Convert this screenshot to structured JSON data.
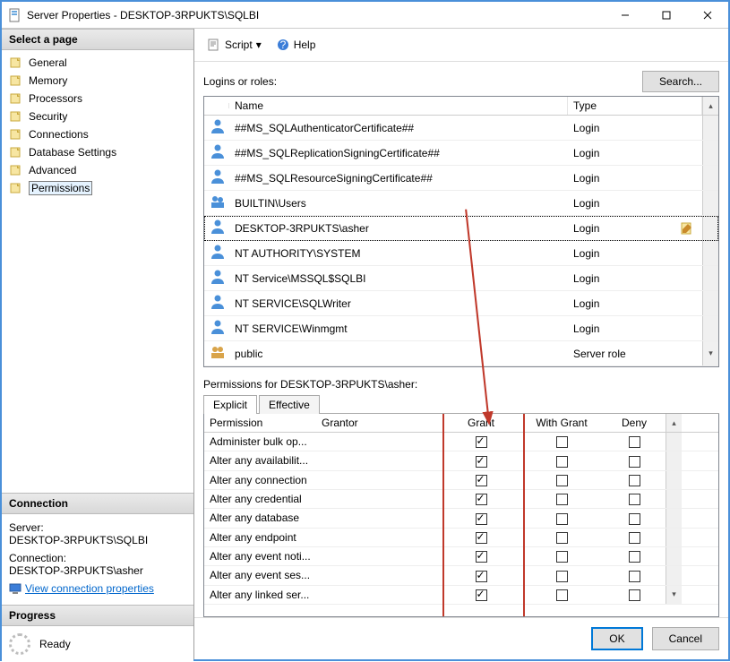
{
  "window": {
    "title": "Server Properties - DESKTOP-3RPUKTS\\SQLBI"
  },
  "left": {
    "select_page": "Select a page",
    "pages": [
      "General",
      "Memory",
      "Processors",
      "Security",
      "Connections",
      "Database Settings",
      "Advanced",
      "Permissions"
    ],
    "selected_page_index": 7,
    "connection_head": "Connection",
    "server_label": "Server:",
    "server_value": "DESKTOP-3RPUKTS\\SQLBI",
    "connection_label": "Connection:",
    "connection_value": "DESKTOP-3RPUKTS\\asher",
    "view_conn_props": "View connection properties",
    "progress_head": "Progress",
    "progress_status": "Ready"
  },
  "toolbar": {
    "script": "Script",
    "help": "Help"
  },
  "logins": {
    "label": "Logins or roles:",
    "search": "Search...",
    "headers": {
      "name": "Name",
      "type": "Type"
    },
    "rows": [
      {
        "name": "##MS_SQLAuthenticatorCertificate##",
        "type": "Login",
        "kind": "cert"
      },
      {
        "name": "##MS_SQLReplicationSigningCertificate##",
        "type": "Login",
        "kind": "cert"
      },
      {
        "name": "##MS_SQLResourceSigningCertificate##",
        "type": "Login",
        "kind": "cert"
      },
      {
        "name": "BUILTIN\\Users",
        "type": "Login",
        "kind": "group"
      },
      {
        "name": "DESKTOP-3RPUKTS\\asher",
        "type": "Login",
        "kind": "user",
        "selected": true
      },
      {
        "name": "NT AUTHORITY\\SYSTEM",
        "type": "Login",
        "kind": "user"
      },
      {
        "name": "NT Service\\MSSQL$SQLBI",
        "type": "Login",
        "kind": "user"
      },
      {
        "name": "NT SERVICE\\SQLWriter",
        "type": "Login",
        "kind": "user"
      },
      {
        "name": "NT SERVICE\\Winmgmt",
        "type": "Login",
        "kind": "user"
      },
      {
        "name": "public",
        "type": "Server role",
        "kind": "role"
      }
    ]
  },
  "permissions": {
    "label_prefix": "Permissions for ",
    "for": "DESKTOP-3RPUKTS\\asher",
    "tabs": [
      "Explicit",
      "Effective"
    ],
    "active_tab": 0,
    "headers": {
      "permission": "Permission",
      "grantor": "Grantor",
      "grant": "Grant",
      "with_grant": "With Grant",
      "deny": "Deny"
    },
    "rows": [
      {
        "permission": "Administer bulk op...",
        "grant": true,
        "with_grant": false,
        "deny": false
      },
      {
        "permission": "Alter any availabilit...",
        "grant": true,
        "with_grant": false,
        "deny": false
      },
      {
        "permission": "Alter any connection",
        "grant": true,
        "with_grant": false,
        "deny": false
      },
      {
        "permission": "Alter any credential",
        "grant": true,
        "with_grant": false,
        "deny": false
      },
      {
        "permission": "Alter any database",
        "grant": true,
        "with_grant": false,
        "deny": false
      },
      {
        "permission": "Alter any endpoint",
        "grant": true,
        "with_grant": false,
        "deny": false
      },
      {
        "permission": "Alter any event noti...",
        "grant": true,
        "with_grant": false,
        "deny": false
      },
      {
        "permission": "Alter any event ses...",
        "grant": true,
        "with_grant": false,
        "deny": false
      },
      {
        "permission": "Alter any linked ser...",
        "grant": true,
        "with_grant": false,
        "deny": false
      }
    ]
  },
  "footer": {
    "ok": "OK",
    "cancel": "Cancel"
  },
  "annotation": {
    "highlight_color": "#c0392b",
    "arrow_from": "selected login row",
    "arrow_to": "Grant column"
  }
}
